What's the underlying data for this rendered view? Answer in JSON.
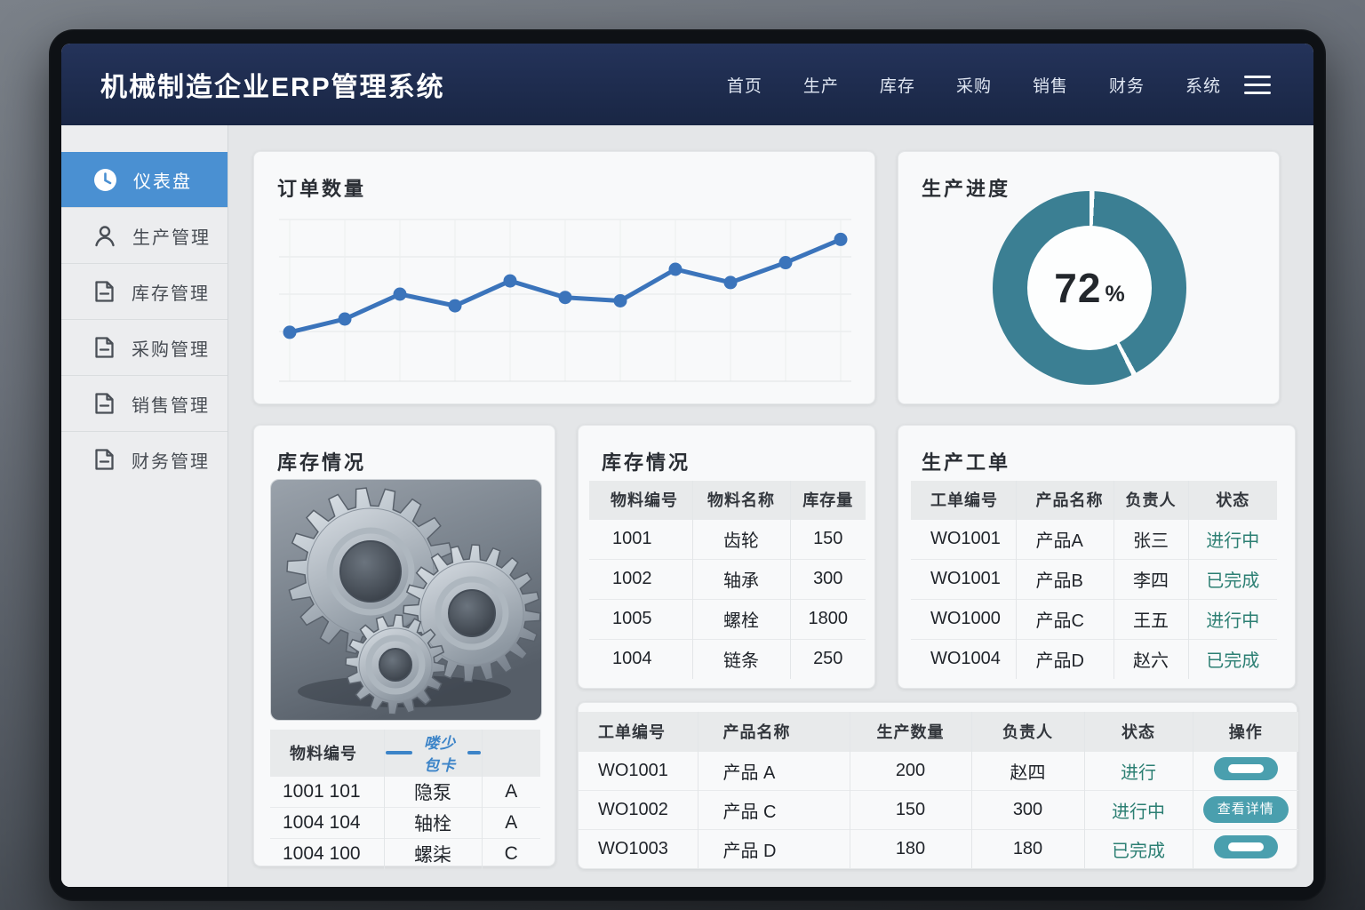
{
  "app": {
    "title": "机械制造企业ERP管理系统"
  },
  "nav": {
    "items": [
      "首页",
      "生产",
      "库存",
      "采购",
      "销售",
      "财务",
      "系统"
    ]
  },
  "sidebar": {
    "items": [
      {
        "label": "仪表盘",
        "icon": "clock-icon",
        "active": true
      },
      {
        "label": "生产管理",
        "icon": "user-icon",
        "active": false
      },
      {
        "label": "库存管理",
        "icon": "document-icon",
        "active": false
      },
      {
        "label": "采购管理",
        "icon": "document-icon",
        "active": false
      },
      {
        "label": "销售管理",
        "icon": "document-icon",
        "active": false
      },
      {
        "label": "财务管理",
        "icon": "document-icon",
        "active": false
      }
    ]
  },
  "cards": {
    "orders_chart": {
      "title": "订单数量"
    },
    "progress": {
      "title": "生产进度",
      "percent_value": "72",
      "percent_sign": "%"
    },
    "inventory_photo": {
      "title": "库存情况",
      "photo_alt": "metal-gears-photo",
      "table": {
        "headers": [
          "物料编号",
          "喽少包卡",
          ""
        ],
        "rows": [
          [
            "1001 101",
            "隐泵",
            "A"
          ],
          [
            "1004 104",
            "轴栓",
            "A"
          ],
          [
            "1004 100",
            "螺柒",
            "C"
          ]
        ]
      }
    },
    "inventory": {
      "title": "库存情况",
      "headers": [
        "物料编号",
        "物料名称",
        "库存量"
      ],
      "rows": [
        [
          "1001",
          "齿轮",
          "150"
        ],
        [
          "1002",
          "轴承",
          "300"
        ],
        [
          "1005",
          "螺栓",
          "1800"
        ],
        [
          "1004",
          "链条",
          "250"
        ]
      ]
    },
    "work_orders": {
      "title": "生产工单",
      "headers": [
        "工单编号",
        "产品名称",
        "负责人",
        "状态"
      ],
      "rows": [
        [
          "WO1001",
          "产品A",
          "张三",
          "进行中"
        ],
        [
          "WO1001",
          "产品B",
          "李四",
          "已完成"
        ],
        [
          "WO1000",
          "产品C",
          "王五",
          "进行中"
        ],
        [
          "WO1004",
          "产品D",
          "赵六",
          "已完成"
        ]
      ]
    },
    "orders_table": {
      "headers": [
        "工单编号",
        "产品名称",
        "生产数量",
        "负责人",
        "状态",
        "操作"
      ],
      "rows": [
        {
          "cells": [
            "WO1001",
            "产品 A",
            "200",
            "赵四",
            "进行"
          ],
          "action": {
            "type": "blank",
            "label": ""
          }
        },
        {
          "cells": [
            "WO1002",
            "产品 C",
            "150",
            "300",
            "进行中"
          ],
          "action": {
            "type": "text",
            "label": "查看详情"
          }
        },
        {
          "cells": [
            "WO1003",
            "产品 D",
            "180",
            "180",
            "已完成"
          ],
          "action": {
            "type": "blank",
            "label": ""
          }
        }
      ]
    }
  },
  "chart_data": [
    {
      "type": "line",
      "title": "订单数量",
      "x": [
        1,
        2,
        3,
        4,
        5,
        6,
        7,
        8,
        9,
        10,
        11
      ],
      "values": [
        110,
        150,
        225,
        190,
        265,
        215,
        205,
        300,
        260,
        320,
        390
      ],
      "xlabel": "",
      "ylabel": "",
      "ylim": [
        0,
        450
      ],
      "grid": true,
      "legend": "none",
      "line_color": "#3b74bb"
    },
    {
      "type": "donut",
      "title": "生产进度",
      "center_label": "72%",
      "percent": 72,
      "segments": [
        {
          "value": 42,
          "color": "#3b7f93"
        },
        {
          "value": 58,
          "color": "#3b7f93"
        }
      ],
      "ring_color": "#3b7f93",
      "hole_color": "#fdfefe"
    }
  ],
  "colors": {
    "header_bg": "#1d2b4c",
    "accent_blue": "#4a90d2",
    "chart_blue": "#3b74bb",
    "teal_ring": "#3b7f93",
    "status_teal": "#2c7f73",
    "button_teal": "#4a9fae",
    "scribble_blue": "#3c84c8"
  }
}
